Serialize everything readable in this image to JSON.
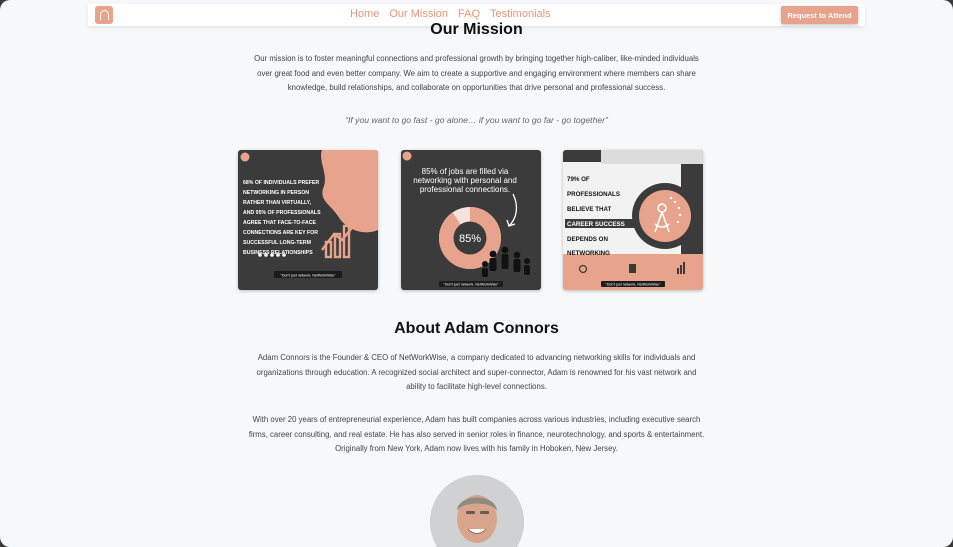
{
  "nav": {
    "links": [
      "Home",
      "Our Mission",
      "FAQ",
      "Testimonials"
    ],
    "cta_label": "Request to Attend"
  },
  "mission": {
    "heading": "Our Mission",
    "body_lines": [
      "Our mission is to foster meaningful connections and professional growth by bringing together high-caliber, like-minded individuals",
      "over great food and even better company. We aim to create a supportive and engaging environment where members can share",
      "knowledge, build relationships, and collaborate on opportunities that drive personal and professional success."
    ],
    "quote": "“If you want to go fast - go alone… if you want to go far - go together”"
  },
  "cards": [
    {
      "text_lines": [
        "68% OF INDIVIDUALS PREFER",
        "NETWORKING IN PERSON",
        "RATHER THAN VIRTUALLY,",
        "AND 95% OF PROFESSIONALS",
        "AGREE THAT FACE-TO-FACE",
        "CONNECTIONS ARE KEY FOR",
        "SUCCESSFUL LONG-TERM",
        "BUSINESS RELATIONSHIPS"
      ],
      "tag": "\"Don't just network, NetWorkWise\""
    },
    {
      "headline_lines": [
        "85% of jobs are filled via",
        "networking with personal and",
        "professional connections."
      ],
      "value": "85%",
      "tag": "\"Don't just network, NetWorkWise\""
    },
    {
      "lines": [
        "79% OF",
        "PROFESSIONALS",
        "BELIEVE THAT",
        "CAREER SUCCESS",
        "DEPENDS ON",
        "NETWORKING"
      ],
      "tag": "\"Don't just network, NetWorkWise\""
    }
  ],
  "about": {
    "heading": "About Adam Connors",
    "para1_lines": [
      "Adam Connors is the Founder & CEO of NetWorkWise, a company dedicated to advancing networking skills for individuals and",
      "organizations through education. A recognized social architect and super-connector, Adam is renowned for his vast network and",
      "ability to facilitate high-level connections."
    ],
    "para2_lines": [
      "With over 20 years of entrepreneurial experience, Adam has built companies across various industries, including executive search",
      "firms, career consulting, and real estate. He has also served in senior roles in finance, neurotechnology, and sports & entertainment.",
      "Originally from New York, Adam now lives with his family in Hoboken, New Jersey."
    ]
  },
  "colors": {
    "accent": "#e7a38b",
    "nav_link": "#e8957a",
    "card_dark": "#3b3b3b"
  },
  "icons": [
    "logo-icon",
    "arrow-icon",
    "bar-chart-icon",
    "people-icon",
    "compass-logo-icon"
  ]
}
